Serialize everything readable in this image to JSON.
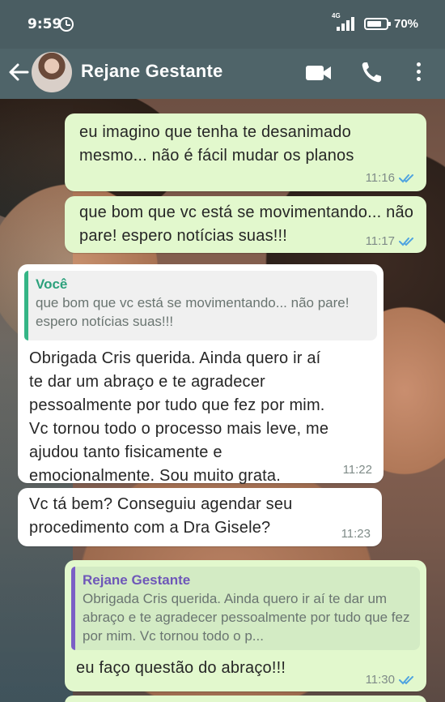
{
  "status_bar": {
    "time": "9:59",
    "network": "4G",
    "battery": "70%"
  },
  "header": {
    "contact_name": "Rejane Gestante",
    "icons": [
      "back-arrow-icon",
      "video-call-icon",
      "phone-icon",
      "more-vertical-icon"
    ]
  },
  "messages": [
    {
      "direction": "outgoing",
      "text": "eu imagino que tenha te desanimado mesmo... não é fácil mudar os planos",
      "time": "11:16",
      "status": "read"
    },
    {
      "direction": "outgoing",
      "text": "que bom que vc está se movimentando... não pare! espero notícias suas!!!",
      "time": "11:17",
      "status": "read"
    },
    {
      "direction": "incoming",
      "quote_author": "Você",
      "quote_text": "que bom que vc está se movimentando... não pare! espero notícias suas!!!",
      "text": "Obrigada Cris querida. Ainda quero ir aí te dar um abraço e te agradecer pessoalmente por tudo que fez por mim. Vc tornou todo o processo mais leve, me ajudou tanto fisicamente e emocionalmente. Sou muito grata.",
      "time": "11:22"
    },
    {
      "direction": "incoming",
      "text": "Vc tá bem? Conseguiu agendar seu procedimento com a Dra Gisele?",
      "time": "11:23"
    },
    {
      "direction": "outgoing",
      "quote_author": "Rejane Gestante",
      "quote_text": "Obrigada Cris querida. Ainda quero ir aí te dar um abraço e te agradecer pessoalmente por tudo que fez por mim. Vc tornou todo o p...",
      "text": "eu faço questão do abraço!!!",
      "time": "11:30",
      "status": "read"
    }
  ],
  "colors": {
    "outgoing_bubble": "#e2f8cd",
    "incoming_bubble": "#ffffff",
    "read_ticks": "#4fa3e0",
    "header": "#4f6469"
  }
}
